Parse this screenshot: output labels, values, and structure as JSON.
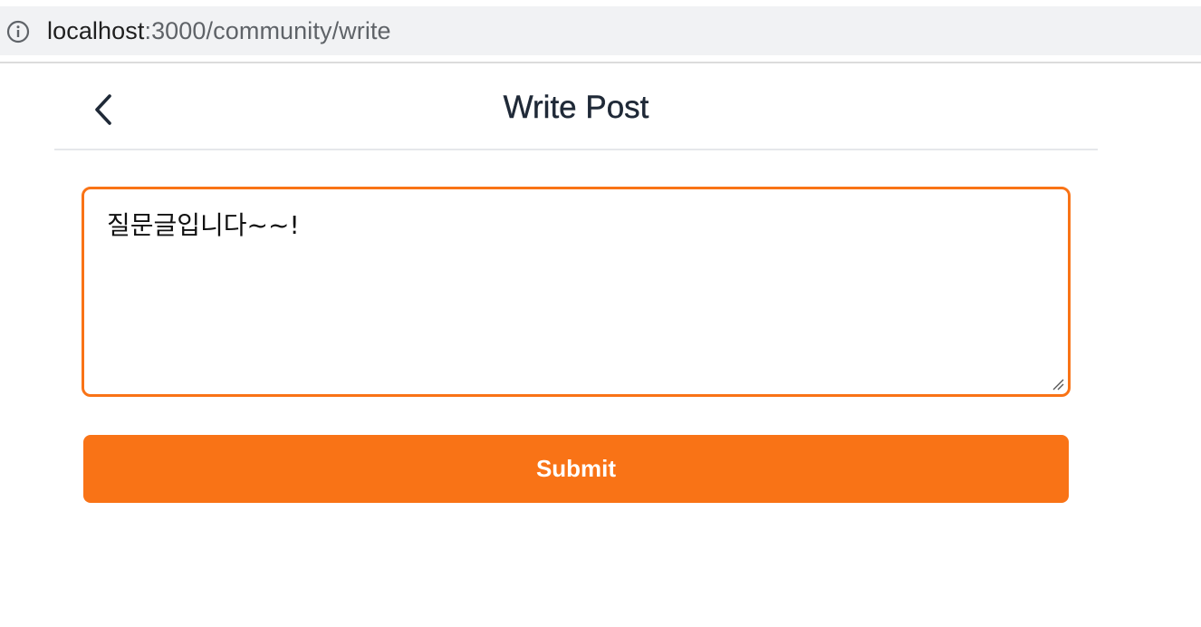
{
  "browser": {
    "url_host": "localhost",
    "url_path": ":3000/community/write",
    "info_icon": "info-circle-icon"
  },
  "header": {
    "back_icon": "chevron-left-icon",
    "title": "Write Post"
  },
  "form": {
    "textarea_value": "질문글입니다~~!",
    "submit_label": "Submit"
  },
  "colors": {
    "accent": "#f97316",
    "title_text": "#1f2937",
    "divider": "#e5e7eb"
  }
}
